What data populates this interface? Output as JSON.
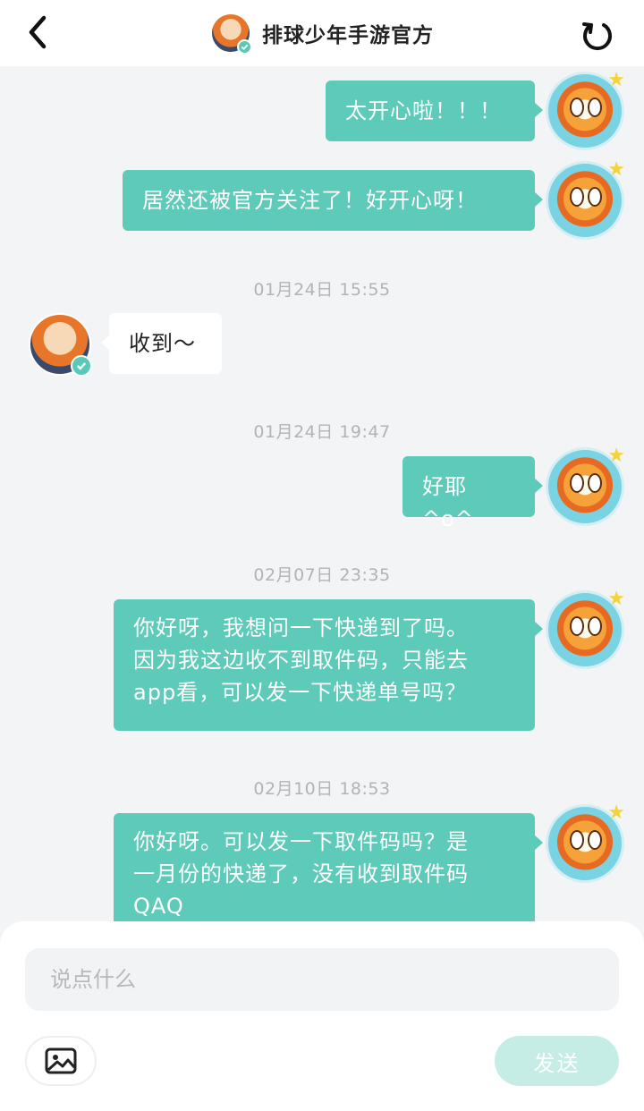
{
  "header": {
    "title": "排球少年手游官方",
    "back_icon": "chevron-left-icon",
    "refresh_icon": "refresh-icon"
  },
  "colors": {
    "accent": "#5ecab9",
    "send_disabled": "#c6ece6",
    "background": "#f3f4f6"
  },
  "messages": {
    "m1": "太开心啦！！！",
    "m2": "居然还被官方关注了！好开心呀！",
    "t1": "01月24日 15:55",
    "m3": "收到～",
    "t2": "01月24日 19:47",
    "m4": "好耶^o^",
    "t3": "02月07日 23:35",
    "m5_line1": "你好呀，我想问一下快递到了吗。",
    "m5_line2": "因为我这边收不到取件码，只能去",
    "m5_line3": "app看，可以发一下快递单号吗？",
    "t4": "02月10日 18:53",
    "m6_line1": "你好呀。可以发一下取件码吗？是",
    "m6_line2": "一月份的快递了，没有收到取件码",
    "m6_line3": "QAQ"
  },
  "composer": {
    "placeholder": "说点什么",
    "send_label": "发送",
    "image_icon": "image-icon"
  }
}
